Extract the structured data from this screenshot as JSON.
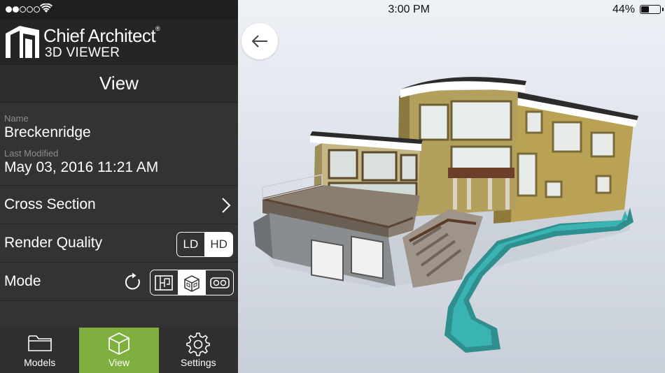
{
  "status_bar": {
    "time": "3:00 PM",
    "battery_percent": "44%",
    "battery_level": 0.44,
    "signal_bars_filled": 2,
    "signal_bars_total": 5
  },
  "brand": {
    "line1": "Chief Architect",
    "registered": "®",
    "line2": "3D VIEWER"
  },
  "view": {
    "title": "View"
  },
  "model_info": {
    "name_label": "Name",
    "name_value": "Breckenridge",
    "modified_label": "Last Modified",
    "modified_value": "May 03, 2016 11:21 AM"
  },
  "settings": {
    "cross_section_label": "Cross Section",
    "render_quality_label": "Render Quality",
    "render_quality_options": [
      "LD",
      "HD"
    ],
    "render_quality_selected": "HD",
    "mode_label": "Mode",
    "mode_options": [
      "plan-icon",
      "3d-box-icon",
      "vr-goggles-icon"
    ],
    "mode_selected": "3d-box-icon"
  },
  "tabs": [
    {
      "label": "Models",
      "icon": "folder-icon"
    },
    {
      "label": "View",
      "icon": "cube-icon"
    },
    {
      "label": "Settings",
      "icon": "gear-icon"
    }
  ],
  "active_tab": "View",
  "colors": {
    "accent": "#7fb03f",
    "panel": "#333333",
    "header": "#252525"
  }
}
